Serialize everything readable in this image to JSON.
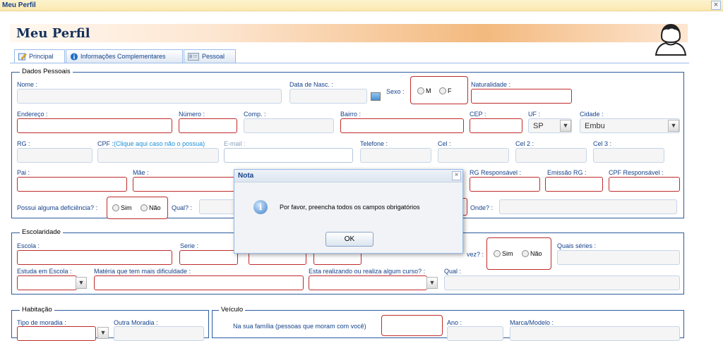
{
  "window": {
    "title": "Meu Perfil",
    "close": "×"
  },
  "page_title": "Meu Perfil",
  "tabs": [
    {
      "label": "Principal"
    },
    {
      "label": "Informações Complementares"
    },
    {
      "label": "Pessoal"
    }
  ],
  "dados_pessoais": {
    "legend": "Dados Pessoais",
    "nome": "Nome :",
    "data_nasc": "Data de Nasc. :",
    "sexo": "Sexo :",
    "sexo_m": "M",
    "sexo_f": "F",
    "naturalidade": "Naturalidade :",
    "endereco": "Endereço :",
    "numero": "Número :",
    "comp": "Comp. :",
    "bairro": "Bairro :",
    "cep": "CEP :",
    "uf": "UF :",
    "uf_value": "SP",
    "cidade": "Cidade :",
    "cidade_value": "Embu",
    "rg": "RG :",
    "cpf": "CPF :",
    "cpf_hint": "(Clique aqui caso não o possua)",
    "email": "E-mail :",
    "telefone": "Telefone :",
    "cel": "Cel :",
    "cel2": "Cel 2 :",
    "cel3": "Cel 3 :",
    "pai": "Pai :",
    "mae": "Mãe :",
    "rg_resp": "RG Responsável :",
    "emissao_rg": "Emissão RG :",
    "cpf_resp": "CPF Responsável :",
    "deficiencia": "Possui alguma deficiência? :",
    "sim": "Sim",
    "nao": "Não",
    "qual": "Qual? :",
    "onde": "Onde? :"
  },
  "escolaridade": {
    "legend": "Escolaridade",
    "escola": "Escola :",
    "serie": "Serie :",
    "vez": "vez? :",
    "sim": "Sim",
    "nao": "Não",
    "quais_series": "Quais séries :",
    "estuda_escola": "Estuda em Escola :",
    "materia": "Matéria que tem mais dificuldade :",
    "curso": "Esta realizando ou realiza algum curso? :",
    "qual": "Qual :"
  },
  "habitacao": {
    "legend": "Habitação",
    "tipo": "Tipo de moradia :",
    "outra": "Outra Moradia :"
  },
  "veiculo": {
    "legend": "Veículo",
    "familia": "Na sua família (pessoas que moram com você)",
    "ano": "Ano :",
    "marca": "Marca/Modelo :"
  },
  "dialog": {
    "title": "Nota",
    "message": "Por favor, preencha todos os campos obrigatórios",
    "ok": "OK",
    "close": "×"
  }
}
